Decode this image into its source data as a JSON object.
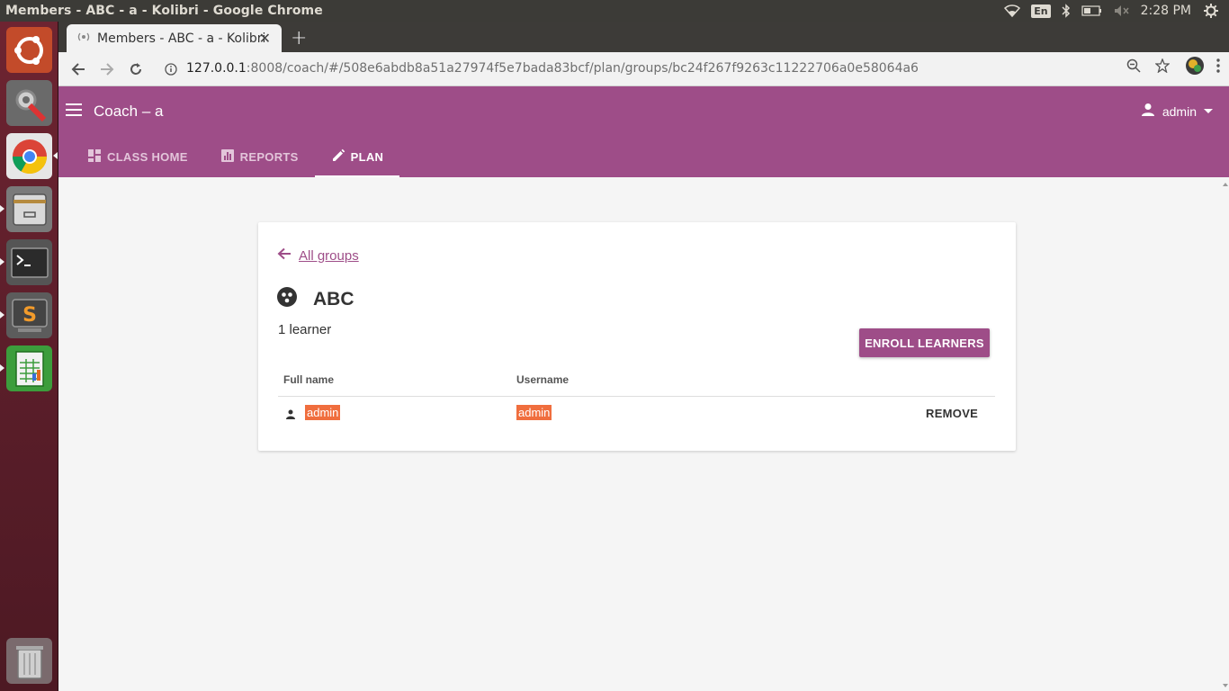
{
  "os": {
    "window_title": "Members - ABC - a - Kolibri - Google Chrome",
    "lang": "En",
    "clock": "2:28 PM"
  },
  "browser": {
    "tab_title": "Members - ABC - a - Kolibri",
    "url_host": "127.0.0.1",
    "url_rest": ":8008/coach/#/508e6abdb8a51a27974f5e7bada83bcf/plan/groups/bc24f267f9263c11222706a0e58064a6"
  },
  "appbar": {
    "title": "Coach – a",
    "user": "admin",
    "tabs": [
      {
        "label": "CLASS HOME",
        "icon": "dashboard-icon"
      },
      {
        "label": "REPORTS",
        "icon": "bar-chart-icon"
      },
      {
        "label": "PLAN",
        "icon": "pencil-icon",
        "active": true
      }
    ]
  },
  "group": {
    "back_label": "All groups",
    "name": "ABC",
    "learner_count": "1 learner",
    "enroll_label": "ENROLL LEARNERS",
    "columns": {
      "full_name": "Full name",
      "username": "Username"
    },
    "rows": [
      {
        "full_name": "admin",
        "username": "admin",
        "action": "REMOVE"
      }
    ]
  },
  "colors": {
    "brand": "#9e4d88",
    "highlight": "#f06e3e"
  }
}
